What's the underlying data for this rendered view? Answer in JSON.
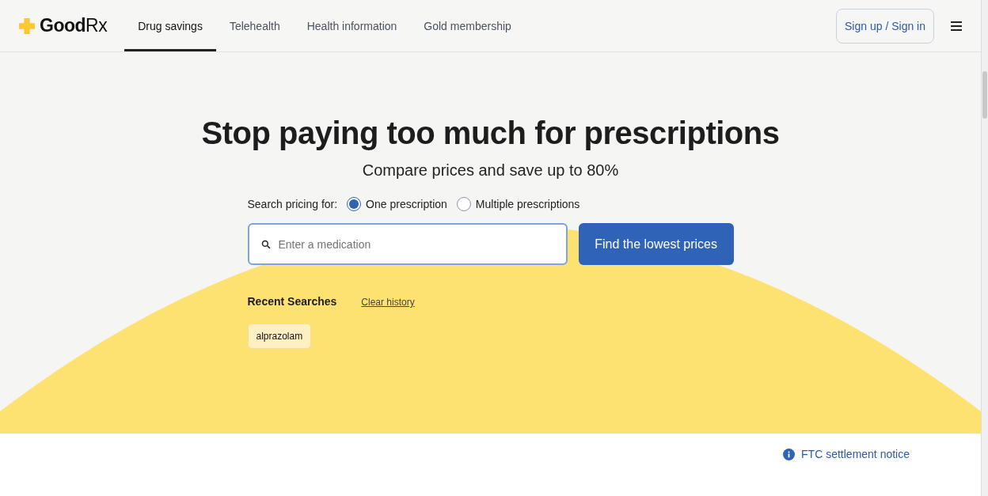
{
  "header": {
    "logo": "**Good**Rx",
    "nav": [
      {
        "label": "Drug savings",
        "selected": true
      },
      {
        "label": "Telehealth",
        "selected": false
      },
      {
        "label": "Health information",
        "selected": false
      },
      {
        "label": "Gold membership",
        "selected": false
      }
    ],
    "sign_in": "Sign up / Sign in"
  },
  "hero": {
    "title": "Stop paying too much for prescriptions",
    "subtitle": "Compare prices and save up to 80%",
    "search_mode": {
      "label": "Search pricing for:",
      "options": [
        {
          "label": "One prescription",
          "selected": true
        },
        {
          "label": "Multiple prescriptions",
          "selected": false
        }
      ]
    },
    "search": {
      "placeholder": "Enter a medication"
    },
    "submit": "Find the lowest prices",
    "recent": {
      "title": "Recent Searches",
      "clear": "Clear history",
      "items": [
        "alprazolam"
      ]
    }
  },
  "notice": "FTC settlement notice"
}
